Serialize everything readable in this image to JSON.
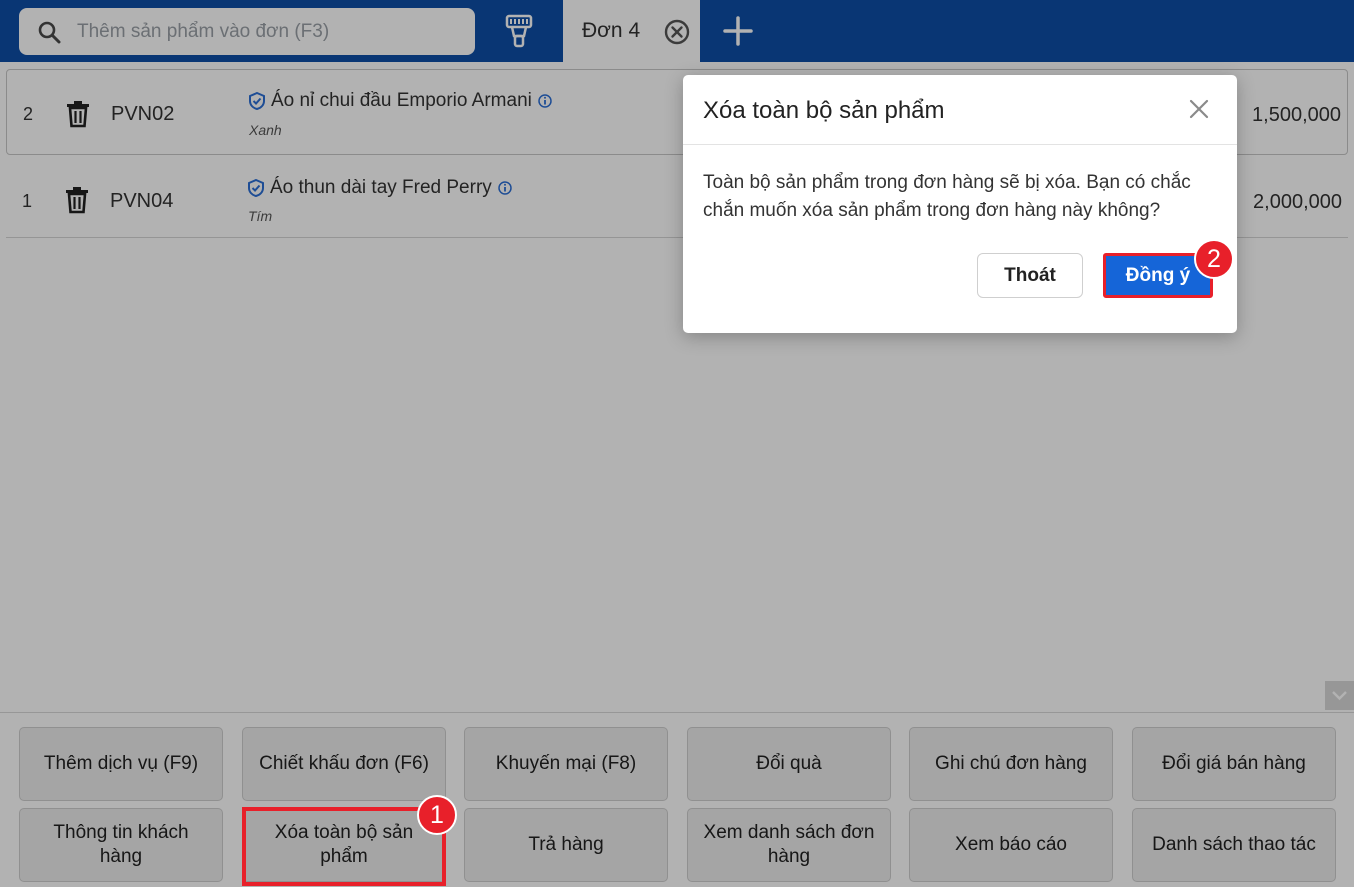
{
  "search": {
    "placeholder": "Thêm sản phẩm vào đơn (F3)"
  },
  "tab": {
    "label": "Đơn 4"
  },
  "icons": [
    "search-icon",
    "barcode-scanner-icon",
    "close-circle-icon",
    "plus-icon",
    "trash-icon",
    "verified-shield-icon",
    "info-icon",
    "chevron-down-icon",
    "close-icon"
  ],
  "colors": {
    "topbar": "#0d4ea6",
    "primary": "#1565d8",
    "callout": "#e8202a"
  },
  "order_items": [
    {
      "index": "2",
      "sku": "PVN02",
      "name": "Áo nỉ chui đầu Emporio Armani",
      "variant": "Xanh",
      "price": "1,500,000"
    },
    {
      "index": "1",
      "sku": "PVN04",
      "name": "Áo thun dài tay Fred Perry",
      "variant": "Tím",
      "price": "2,000,000"
    }
  ],
  "actions": [
    "Thêm dịch vụ (F9)",
    "Chiết khấu đơn (F6)",
    "Khuyến mại (F8)",
    "Đổi quà",
    "Ghi chú đơn hàng",
    "Đổi giá bán hàng",
    "Thông tin khách hàng",
    "Xóa toàn bộ sản phẩm",
    "Trả hàng",
    "Xem danh sách đơn hàng",
    "Xem báo cáo",
    "Danh sách thao tác"
  ],
  "modal": {
    "title": "Xóa toàn bộ sản phẩm",
    "message": "Toàn bộ sản phẩm trong đơn hàng sẽ bị xóa. Bạn có chắc chắn muốn xóa sản phẩm trong đơn hàng này không?",
    "cancel_label": "Thoát",
    "confirm_label": "Đồng ý"
  },
  "callouts": {
    "step1": "1",
    "step2": "2"
  }
}
